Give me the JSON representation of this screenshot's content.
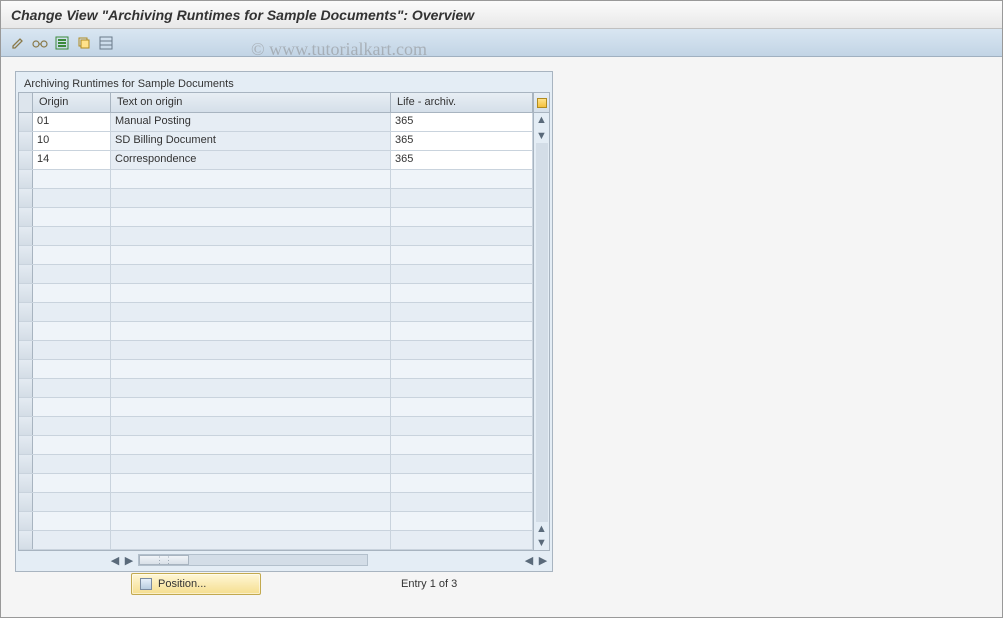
{
  "title": "Change View \"Archiving Runtimes for Sample Documents\": Overview",
  "watermark": "© www.tutorialkart.com",
  "toolbar_icons": [
    "pencil-icon",
    "glasses-icon",
    "new-entries-icon",
    "copy-icon",
    "delimit-icon"
  ],
  "table": {
    "title": "Archiving Runtimes for Sample Documents",
    "columns": {
      "origin": "Origin",
      "text": "Text on origin",
      "life": "Life - archiv."
    },
    "rows": [
      {
        "origin": "01",
        "text": "Manual Posting",
        "life": "365"
      },
      {
        "origin": "10",
        "text": "SD Billing Document",
        "life": "365"
      },
      {
        "origin": "14",
        "text": "Correspondence",
        "life": "365"
      }
    ],
    "empty_row_count": 20
  },
  "footer": {
    "position_label": "Position...",
    "entry_text": "Entry 1 of 3"
  }
}
